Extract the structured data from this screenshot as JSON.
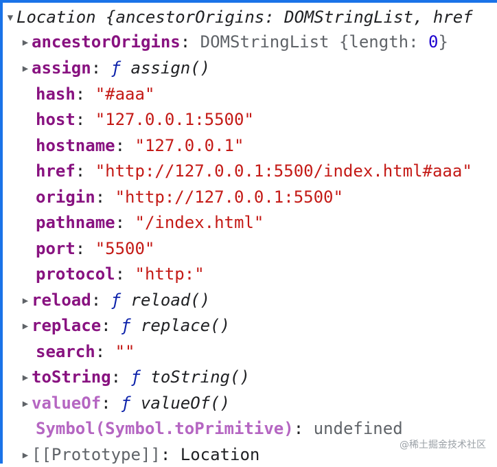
{
  "root": {
    "summary_prefix": "Location ",
    "summary_body": "{ancestorOrigins: DOMStringList, href"
  },
  "rows": {
    "ancestorOrigins": {
      "key": "ancestorOrigins",
      "type": "DOMStringList ",
      "detail_open": "{length: ",
      "detail_num": "0",
      "detail_close": "}"
    },
    "assign": {
      "key": "assign",
      "f": "ƒ",
      "fname": "assign()"
    },
    "hash": {
      "key": "hash",
      "value": "\"#aaa\""
    },
    "host": {
      "key": "host",
      "value": "\"127.0.0.1:5500\""
    },
    "hostname": {
      "key": "hostname",
      "value": "\"127.0.0.1\""
    },
    "href": {
      "key": "href",
      "value": "\"http://127.0.0.1:5500/index.html#aaa\""
    },
    "origin": {
      "key": "origin",
      "value": "\"http://127.0.0.1:5500\""
    },
    "pathname": {
      "key": "pathname",
      "value": "\"/index.html\""
    },
    "port": {
      "key": "port",
      "value": "\"5500\""
    },
    "protocol": {
      "key": "protocol",
      "value": "\"http:\""
    },
    "reload": {
      "key": "reload",
      "f": "ƒ",
      "fname": "reload()"
    },
    "replace": {
      "key": "replace",
      "f": "ƒ",
      "fname": "replace()"
    },
    "search": {
      "key": "search",
      "value": "\"\""
    },
    "toString": {
      "key": "toString",
      "f": "ƒ",
      "fname": "toString()"
    },
    "valueOf": {
      "key": "valueOf",
      "f": "ƒ",
      "fname": "valueOf()"
    },
    "symbol": {
      "key": "Symbol(Symbol.toPrimitive)",
      "value": "undefined"
    },
    "prototype": {
      "key": "[[Prototype]]",
      "value": "Location"
    }
  },
  "glyphs": {
    "expanded": "▼",
    "collapsed": "▶"
  },
  "watermark": "@稀土掘金技术社区"
}
